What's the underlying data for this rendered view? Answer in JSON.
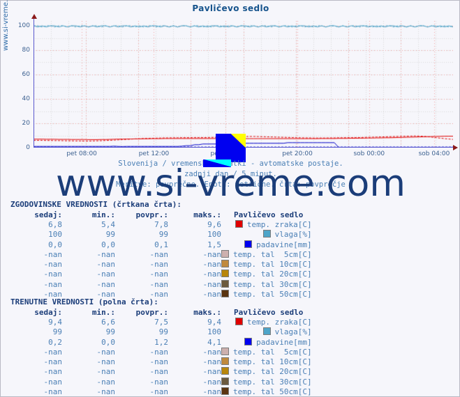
{
  "page": {
    "background": "#f6f6fb",
    "border_color": "#b9b9c4"
  },
  "chart_title": "Pavličevo sedlo",
  "vertical_watermark": "www.si-vreme.com",
  "watermark": "www.si-vreme.com",
  "subtitle": {
    "line1_before_flag": "Slovenija / vremenski p",
    "line1": "Slovenija / vremenski podatki - avtomatske postaje.",
    "line2": "zadnji dan / 5 minut.",
    "line3": "Meritve: povprečne. Enota: metrične. črta: povprečje"
  },
  "tables": [
    {
      "id": "historical",
      "title": "ZGODOVINSKE VREDNOSTI (črtkana črta):",
      "headers": [
        "sedaj:",
        "min.:",
        "povpr.:",
        "maks.:",
        "Pavličevo sedlo"
      ],
      "rows": [
        {
          "sedaj": "6,8",
          "min": "5,4",
          "povpr": "7,8",
          "maks": "9,6",
          "color": "#e00000",
          "label": "temp. zraka[C]"
        },
        {
          "sedaj": "100",
          "min": "99",
          "povpr": "99",
          "maks": "100",
          "color": "#4ea5c9",
          "label": "vlaga[%]"
        },
        {
          "sedaj": "0,0",
          "min": "0,0",
          "povpr": "0,1",
          "maks": "1,5",
          "color": "#0000f0",
          "label": "padavine[mm]"
        },
        {
          "sedaj": "-nan",
          "min": "-nan",
          "povpr": "-nan",
          "maks": "-nan",
          "color": "#cdb0ae",
          "label": "temp. tal  5cm[C]"
        },
        {
          "sedaj": "-nan",
          "min": "-nan",
          "povpr": "-nan",
          "maks": "-nan",
          "color": "#c08a3e",
          "label": "temp. tal 10cm[C]"
        },
        {
          "sedaj": "-nan",
          "min": "-nan",
          "povpr": "-nan",
          "maks": "-nan",
          "color": "#b8860b",
          "label": "temp. tal 20cm[C]"
        },
        {
          "sedaj": "-nan",
          "min": "-nan",
          "povpr": "-nan",
          "maks": "-nan",
          "color": "#6b5a3e",
          "label": "temp. tal 30cm[C]"
        },
        {
          "sedaj": "-nan",
          "min": "-nan",
          "povpr": "-nan",
          "maks": "-nan",
          "color": "#5a3410",
          "label": "temp. tal 50cm[C]"
        }
      ]
    },
    {
      "id": "current",
      "title": "TRENUTNE VREDNOSTI (polna črta):",
      "headers": [
        "sedaj:",
        "min.:",
        "povpr.:",
        "maks.:",
        "Pavličevo sedlo"
      ],
      "rows": [
        {
          "sedaj": "9,4",
          "min": "6,6",
          "povpr": "7,5",
          "maks": "9,4",
          "color": "#e00000",
          "label": "temp. zraka[C]"
        },
        {
          "sedaj": "99",
          "min": "99",
          "povpr": "99",
          "maks": "100",
          "color": "#4ea5c9",
          "label": "vlaga[%]"
        },
        {
          "sedaj": "0,2",
          "min": "0,0",
          "povpr": "1,2",
          "maks": "4,1",
          "color": "#0000f0",
          "label": "padavine[mm]"
        },
        {
          "sedaj": "-nan",
          "min": "-nan",
          "povpr": "-nan",
          "maks": "-nan",
          "color": "#cdb0ae",
          "label": "temp. tal  5cm[C]"
        },
        {
          "sedaj": "-nan",
          "min": "-nan",
          "povpr": "-nan",
          "maks": "-nan",
          "color": "#c08a3e",
          "label": "temp. tal 10cm[C]"
        },
        {
          "sedaj": "-nan",
          "min": "-nan",
          "povpr": "-nan",
          "maks": "-nan",
          "color": "#b8860b",
          "label": "temp. tal 20cm[C]"
        },
        {
          "sedaj": "-nan",
          "min": "-nan",
          "povpr": "-nan",
          "maks": "-nan",
          "color": "#6b5a3e",
          "label": "temp. tal 30cm[C]"
        },
        {
          "sedaj": "-nan",
          "min": "-nan",
          "povpr": "-nan",
          "maks": "-nan",
          "color": "#5a3410",
          "label": "temp. tal 50cm[C]"
        }
      ]
    }
  ],
  "chart_data": {
    "type": "line",
    "title": "Pavličevo sedlo",
    "xlabel": "",
    "ylabel": "",
    "ylim": [
      0,
      104
    ],
    "yticks": [
      0,
      20,
      40,
      60,
      80,
      100
    ],
    "xticks": [
      "pet 08:00",
      "pet 12:00",
      "pet 16:00",
      "pet 20:00",
      "sob 00:00",
      "sob 04:00"
    ],
    "xtick_positions": [
      0.115,
      0.287,
      0.458,
      0.629,
      0.8,
      0.955
    ],
    "grid": true,
    "grid_color": "#f0a0a0",
    "legend_position": "below-table",
    "series": [
      {
        "name": "vlaga[%] (trenutne)",
        "color": "#4ea5c9",
        "style": "solid",
        "unit": "%",
        "values": [
          100,
          99,
          100,
          99,
          100,
          100,
          99,
          100,
          99,
          100,
          100,
          99,
          100,
          99,
          100,
          99,
          100,
          100,
          99,
          100,
          99,
          100,
          100,
          99,
          100,
          99,
          100,
          99,
          100,
          100,
          99,
          100,
          99,
          100,
          99,
          100,
          100,
          99,
          100,
          99,
          100,
          99,
          100,
          100,
          99,
          100,
          99,
          100,
          99,
          100,
          100,
          99,
          100,
          99,
          100,
          99,
          100,
          100,
          99,
          100,
          99,
          100,
          99,
          100,
          100,
          99,
          100,
          99,
          100,
          99,
          100,
          100,
          99,
          100,
          99,
          100,
          99,
          100,
          100,
          99,
          100,
          99,
          100,
          99,
          100,
          100,
          99,
          100,
          99,
          100,
          99,
          100,
          100,
          99,
          100,
          99,
          100,
          99,
          100,
          99
        ]
      },
      {
        "name": "vlaga[%] (zgodovinske)",
        "color": "#4ea5c9",
        "style": "dashed",
        "unit": "%",
        "values": [
          100,
          100,
          99,
          100,
          100,
          99,
          100,
          100,
          99,
          100,
          99,
          100,
          100,
          99,
          100,
          100,
          99,
          100,
          99,
          100,
          100,
          99,
          100,
          100,
          99,
          100,
          99,
          100,
          100,
          99,
          100,
          100,
          99,
          100,
          99,
          100,
          100,
          99,
          100,
          100,
          99,
          100,
          99,
          100,
          100,
          99,
          100,
          100,
          99,
          100,
          99,
          100,
          100,
          99,
          100,
          100,
          99,
          100,
          99,
          100,
          100,
          99,
          100,
          100,
          99,
          100,
          99,
          100,
          100,
          99,
          100,
          100,
          99,
          100,
          99,
          100,
          100,
          99,
          100,
          100,
          99,
          100,
          99,
          100,
          100,
          99,
          100,
          100,
          99,
          100,
          99,
          100,
          100,
          99,
          100,
          100,
          99,
          100,
          99,
          100
        ]
      },
      {
        "name": "temp. zraka[C] (trenutne)",
        "color": "#e00000",
        "style": "solid",
        "unit": "C",
        "values": [
          7.0,
          7.0,
          7.0,
          6.9,
          6.9,
          6.9,
          6.8,
          6.8,
          6.8,
          6.7,
          6.7,
          6.7,
          6.7,
          6.6,
          6.6,
          6.6,
          6.7,
          6.7,
          6.8,
          6.9,
          7.0,
          7.0,
          7.1,
          7.1,
          7.2,
          7.2,
          7.3,
          7.3,
          7.4,
          7.4,
          7.4,
          7.5,
          7.5,
          7.5,
          7.5,
          7.5,
          7.5,
          7.5,
          7.5,
          7.5,
          7.5,
          7.5,
          7.5,
          7.5,
          7.5,
          7.4,
          7.4,
          7.4,
          7.4,
          7.4,
          7.4,
          7.4,
          7.4,
          7.4,
          7.4,
          7.4,
          7.4,
          7.4,
          7.4,
          7.4,
          7.4,
          7.4,
          7.4,
          7.4,
          7.4,
          7.4,
          7.4,
          7.4,
          7.5,
          7.5,
          7.5,
          7.5,
          7.6,
          7.6,
          7.6,
          7.7,
          7.7,
          7.8,
          7.8,
          7.9,
          7.9,
          8.0,
          8.0,
          8.1,
          8.1,
          8.2,
          8.3,
          8.4,
          8.5,
          8.6,
          8.7,
          8.8,
          8.9,
          9.0,
          9.1,
          9.2,
          9.3,
          9.4,
          9.4,
          9.4
        ]
      },
      {
        "name": "temp. zraka[C] (zgodovinske)",
        "color": "#e00000",
        "style": "dashed",
        "unit": "C",
        "values": [
          6.0,
          6.0,
          6.0,
          5.9,
          5.9,
          5.8,
          5.8,
          5.7,
          5.6,
          5.6,
          5.5,
          5.5,
          5.4,
          5.4,
          5.5,
          5.6,
          5.7,
          5.9,
          6.0,
          6.2,
          6.4,
          6.6,
          6.8,
          7.0,
          7.2,
          7.3,
          7.5,
          7.6,
          7.7,
          7.8,
          7.9,
          8.0,
          8.0,
          8.1,
          8.1,
          8.2,
          8.2,
          8.2,
          8.3,
          8.3,
          8.3,
          8.3,
          8.4,
          8.5,
          8.6,
          8.7,
          8.8,
          8.9,
          9.0,
          9.1,
          9.1,
          9.2,
          9.2,
          9.1,
          9.0,
          8.9,
          8.8,
          8.7,
          8.6,
          8.5,
          8.4,
          8.3,
          8.2,
          8.1,
          8.0,
          8.0,
          7.9,
          7.9,
          7.9,
          7.9,
          8.0,
          8.0,
          8.1,
          8.1,
          8.2,
          8.2,
          8.3,
          8.3,
          8.4,
          8.5,
          8.6,
          8.7,
          8.8,
          8.9,
          9.0,
          9.1,
          9.2,
          9.3,
          9.4,
          9.5,
          9.6,
          9.5,
          9.3,
          9.0,
          8.6,
          8.2,
          7.8,
          7.4,
          7.1,
          6.8
        ]
      },
      {
        "name": "padavine[mm] (trenutne)",
        "color": "#0000c8",
        "style": "solid",
        "unit": "mm",
        "values": [
          1.0,
          1.0,
          1.0,
          1.0,
          1.0,
          1.0,
          1.0,
          1.0,
          1.0,
          1.0,
          1.0,
          1.0,
          1.0,
          1.0,
          1.0,
          1.0,
          1.0,
          1.0,
          1.0,
          1.2,
          1.0,
          0.9,
          1.0,
          1.0,
          1.0,
          1.0,
          1.0,
          1.0,
          1.0,
          1.0,
          1.0,
          1.0,
          1.0,
          1.0,
          1.0,
          1.2,
          1.6,
          1.6,
          2.4,
          2.4,
          3.0,
          3.0,
          3.0,
          3.0,
          3.0,
          3.0,
          3.0,
          3.0,
          3.0,
          3.0,
          3.6,
          3.6,
          3.6,
          3.6,
          3.6,
          3.6,
          3.6,
          3.6,
          3.6,
          3.6,
          4.1,
          4.1,
          4.1,
          4.1,
          4.1,
          4.1,
          4.1,
          4.1,
          4.1,
          4.1,
          4.1,
          4.1,
          0.2,
          0.2,
          0.2,
          0.2,
          0.2,
          0.2,
          0.2,
          0.2,
          0.2,
          0.2,
          0.2,
          0.2,
          0.2,
          0.2,
          0.2,
          0.2,
          0.2,
          0.2,
          0.2,
          0.2,
          0.2,
          0.2,
          0.2,
          0.2,
          0.2,
          0.2,
          0.2,
          0.2
        ]
      },
      {
        "name": "padavine[mm] (zgodovinske)",
        "color": "#0000c8",
        "style": "dashed",
        "unit": "mm",
        "values": [
          0.5,
          0.5,
          0.5,
          0.5,
          0.5,
          0.5,
          0.5,
          0.5,
          0.5,
          0.5,
          0.5,
          0.5,
          0.5,
          0.5,
          0.5,
          0.5,
          0.5,
          0.5,
          0.5,
          0.5,
          0.5,
          0.5,
          0.5,
          0.5,
          0.5,
          0.5,
          0.5,
          0.5,
          0.5,
          0.5,
          0.5,
          0.5,
          0.5,
          0.5,
          0.5,
          0.5,
          0.5,
          0.5,
          0.5,
          0.5,
          0.5,
          0.5,
          0.5,
          0.5,
          0.5,
          0.5,
          0.5,
          0.5,
          0.5,
          0.5,
          0.5,
          0.5,
          0.5,
          0.5,
          0.5,
          0.5,
          0.5,
          0.5,
          0.5,
          0.5,
          0.5,
          0.5,
          0.5,
          0.5,
          0.5,
          0.5,
          0.5,
          0.5,
          0.5,
          0.5,
          0.5,
          0.5,
          0.5,
          0.5,
          0.5,
          0.5,
          0.5,
          0.5,
          0.5,
          0.5,
          0.5,
          0.5,
          0.5,
          0.5,
          0.5,
          0.5,
          0.5,
          0.5,
          0.5,
          0.5,
          0.5,
          0.5,
          0.5,
          0.5,
          0.5,
          0.5,
          0.5,
          0.5,
          0.5,
          0.5
        ]
      }
    ]
  }
}
